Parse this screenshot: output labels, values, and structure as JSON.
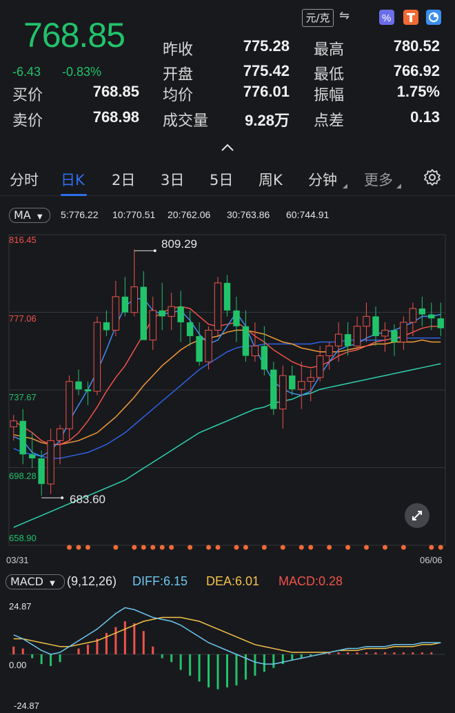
{
  "quote": {
    "price": "768.85",
    "change": "-6.43",
    "change_pct": "-0.83%",
    "unit": "元/克",
    "swap_icon": "⇋",
    "fields": {
      "prev_close_label": "昨收",
      "prev_close": "775.28",
      "high_label": "最高",
      "high": "780.52",
      "open_label": "开盘",
      "open": "775.42",
      "low_label": "最低",
      "low": "766.92",
      "bid_label": "买价",
      "bid": "768.85",
      "avg_label": "均价",
      "avg": "776.01",
      "amp_label": "振幅",
      "amp": "1.75%",
      "ask_label": "卖价",
      "ask": "768.98",
      "volume_label": "成交量",
      "volume": "9.28万",
      "spread_label": "点差",
      "spread": "0.13"
    },
    "up_color": "#f0534a",
    "down_color": "#21c36a"
  },
  "tabs": [
    "分时",
    "日K",
    "2日",
    "3日",
    "5日",
    "周K",
    "分钟",
    "更多"
  ],
  "active_tab": "日K",
  "ma": {
    "selector": "MA",
    "items": [
      {
        "text": "5:776.22",
        "color": "#3f8ff5"
      },
      {
        "text": "10:770.51",
        "color": "#f0534a"
      },
      {
        "text": "20:762.06",
        "color": "#f29a3a"
      },
      {
        "text": "30:763.86",
        "color": "#2f62e8"
      },
      {
        "text": "60:744.91",
        "color": "#2fd3b0"
      }
    ]
  },
  "kline": {
    "y_labels": [
      "816.45",
      "777.06",
      "737.67",
      "698.28",
      "658.90"
    ],
    "max_marker": "809.29",
    "min_marker": "683.60",
    "date_start": "03/31",
    "date_end": "06/06"
  },
  "macd": {
    "selector": "MACD",
    "params": "(9,12,26)",
    "diff": "DIFF:6.15",
    "dea": "DEA:6.01",
    "macd": "MACD:0.28",
    "y_labels": [
      "24.87",
      "0.00",
      "-24.87"
    ],
    "diff_color": "#6ec9f0",
    "dea_color": "#f3c34a",
    "macd_color": "#f0534a"
  },
  "chart_data": {
    "type": "candlestick",
    "title": "",
    "y_range": [
      658.9,
      816.45
    ],
    "x_range": [
      "03/31",
      "06/06"
    ],
    "ohlc": [
      [
        719,
        725,
        712,
        722
      ],
      [
        722,
        728,
        700,
        705
      ],
      [
        705,
        716,
        698,
        703
      ],
      [
        703,
        707,
        684,
        690
      ],
      [
        690,
        718,
        685,
        712
      ],
      [
        712,
        720,
        700,
        718
      ],
      [
        718,
        745,
        712,
        742
      ],
      [
        742,
        748,
        735,
        738
      ],
      [
        738,
        742,
        730,
        737
      ],
      [
        737,
        775,
        735,
        772
      ],
      [
        772,
        778,
        765,
        768
      ],
      [
        768,
        793,
        765,
        785
      ],
      [
        785,
        795,
        775,
        777
      ],
      [
        777,
        809,
        775,
        790
      ],
      [
        790,
        798,
        770,
        763
      ],
      [
        763,
        785,
        758,
        778
      ],
      [
        778,
        792,
        768,
        775
      ],
      [
        775,
        787,
        768,
        780
      ],
      [
        780,
        788,
        762,
        772
      ],
      [
        772,
        778,
        760,
        765
      ],
      [
        765,
        772,
        750,
        752
      ],
      [
        752,
        770,
        748,
        768
      ],
      [
        768,
        795,
        765,
        792
      ],
      [
        792,
        796,
        775,
        778
      ],
      [
        778,
        785,
        762,
        770
      ],
      [
        770,
        778,
        752,
        755
      ],
      [
        755,
        772,
        752,
        760
      ],
      [
        760,
        770,
        745,
        748
      ],
      [
        748,
        752,
        725,
        728
      ],
      [
        728,
        750,
        718,
        745
      ],
      [
        745,
        750,
        735,
        738
      ],
      [
        738,
        752,
        728,
        742
      ],
      [
        742,
        748,
        732,
        744
      ],
      [
        744,
        760,
        742,
        755
      ],
      [
        755,
        762,
        748,
        760
      ],
      [
        760,
        772,
        752,
        766
      ],
      [
        766,
        772,
        755,
        760
      ],
      [
        760,
        775,
        758,
        770
      ],
      [
        770,
        782,
        762,
        775
      ],
      [
        775,
        780,
        760,
        765
      ],
      [
        765,
        772,
        757,
        768
      ],
      [
        768,
        771,
        755,
        762
      ],
      [
        762,
        775,
        758,
        772
      ],
      [
        772,
        782,
        765,
        779
      ],
      [
        779,
        785,
        770,
        776
      ],
      [
        776,
        782,
        768,
        774
      ],
      [
        774,
        782,
        765,
        769
      ]
    ],
    "ma5": [
      714,
      712,
      706,
      704,
      707,
      712,
      722,
      730,
      738,
      747,
      758,
      770,
      780,
      784,
      784,
      778,
      776,
      777,
      778,
      773,
      766,
      761,
      763,
      770,
      777,
      770,
      759,
      750,
      742,
      738,
      736,
      735,
      737,
      745,
      752,
      758,
      760,
      761,
      764,
      766,
      767,
      768,
      770,
      772,
      775,
      775,
      776
    ],
    "ma10": [
      722,
      719,
      716,
      712,
      710,
      710,
      712,
      716,
      722,
      729,
      737,
      744,
      750,
      758,
      766,
      774,
      777,
      779,
      780,
      779,
      775,
      771,
      770,
      771,
      772,
      769,
      765,
      762,
      758,
      755,
      752,
      750,
      749,
      750,
      752,
      755,
      757,
      758,
      760,
      762,
      763,
      764,
      765,
      767,
      769,
      770,
      770
    ],
    "ma20": [
      715,
      714,
      713,
      711,
      710,
      710,
      711,
      712,
      714,
      716,
      720,
      724,
      729,
      734,
      740,
      745,
      750,
      754,
      758,
      761,
      763,
      764,
      765,
      767,
      768,
      768,
      767,
      766,
      764,
      762,
      761,
      759,
      758,
      757,
      757,
      757,
      758,
      759,
      760,
      761,
      761,
      762,
      762,
      762,
      763,
      762,
      762
    ],
    "ma30": [
      708,
      706,
      705,
      704,
      703,
      703,
      704,
      705,
      706,
      708,
      710,
      713,
      716,
      720,
      724,
      728,
      732,
      736,
      740,
      744,
      748,
      751,
      754,
      757,
      759,
      760,
      760,
      761,
      761,
      761,
      761,
      761,
      761,
      762,
      762,
      762,
      763,
      763,
      763,
      763,
      763,
      764,
      764,
      764,
      764,
      764,
      764
    ],
    "ma60": [
      668,
      670,
      672,
      674,
      676,
      678,
      680,
      682,
      684,
      686,
      688,
      690,
      692,
      695,
      698,
      701,
      704,
      707,
      710,
      713,
      716,
      718,
      720,
      722,
      724,
      726,
      728,
      729,
      731,
      732,
      733,
      735,
      736,
      738,
      739,
      740,
      741,
      742,
      743,
      744,
      745,
      746,
      747,
      748,
      749,
      750,
      751
    ],
    "macd_series": [
      {
        "name": "DIFF",
        "values": [
          10,
          8,
          5,
          2,
          0,
          1,
          4,
          7,
          10,
          13,
          17,
          21,
          24,
          23,
          21,
          19,
          18,
          17,
          15,
          12,
          9,
          6,
          4,
          2,
          0,
          -2,
          -4,
          -5,
          -5,
          -4,
          -3,
          -2,
          -1,
          0,
          1,
          2,
          3,
          3,
          4,
          4,
          4,
          5,
          5,
          5,
          6,
          6,
          6
        ]
      },
      {
        "name": "DEA",
        "values": [
          8,
          8,
          7,
          6,
          5,
          4,
          4,
          5,
          6,
          7,
          9,
          11,
          13,
          15,
          17,
          18,
          19,
          19,
          19,
          18,
          17,
          15,
          13,
          11,
          9,
          7,
          5,
          4,
          3,
          2,
          1,
          1,
          1,
          1,
          1,
          2,
          2,
          2,
          3,
          3,
          3,
          4,
          4,
          4,
          5,
          5,
          6
        ]
      },
      {
        "name": "MACD",
        "values": [
          4,
          3,
          -2,
          -5,
          -6,
          -4,
          0,
          3,
          5,
          8,
          11,
          14,
          17,
          16,
          12,
          4,
          -2,
          -4,
          -8,
          -11,
          -14,
          -17,
          -18,
          -17,
          -16,
          -13,
          -11,
          -9,
          -7,
          -5,
          -3,
          -2,
          -1,
          0,
          1,
          1,
          1,
          1,
          1,
          1,
          1,
          1,
          1,
          1,
          1,
          1,
          0
        ]
      }
    ]
  }
}
